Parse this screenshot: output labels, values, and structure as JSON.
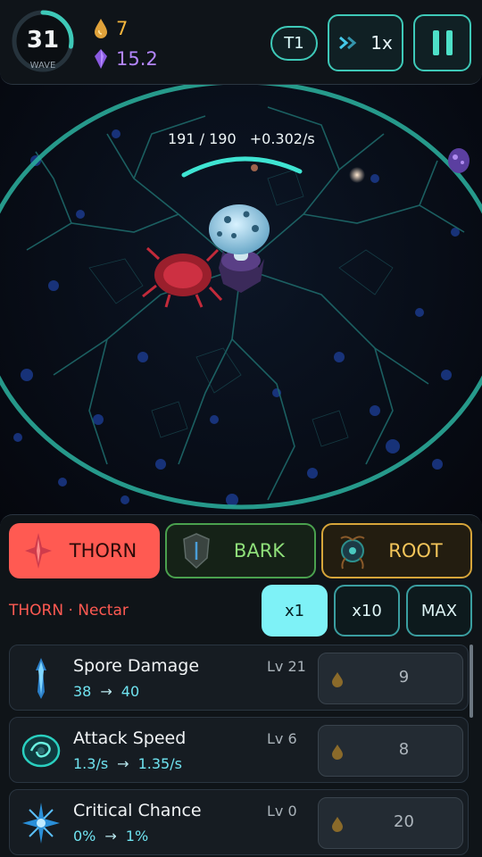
{
  "hud": {
    "wave_number": "31",
    "wave_label": "WAVE",
    "wave_progress": 0.28,
    "nectar_value": "7",
    "crystal_value": "15.2",
    "tier_label": "T1",
    "speed_label": "1x",
    "pause_icon": "pause-icon"
  },
  "battle": {
    "hp_text": "191 / 190",
    "regen_text": "+0.302/s"
  },
  "tabs": [
    {
      "label": "THORN",
      "icon": "thorn-icon",
      "active": true
    },
    {
      "label": "BARK",
      "icon": "bark-shield-icon",
      "active": false
    },
    {
      "label": "ROOT",
      "icon": "root-icon",
      "active": false
    }
  ],
  "section_label": "THORN · Nectar",
  "multipliers": [
    "x1",
    "x10",
    "MAX"
  ],
  "upgrades": [
    {
      "name": "Spore Damage",
      "level": "Lv 21",
      "current": "38",
      "next": "40",
      "cost": "9",
      "icon": "spore-spike-icon"
    },
    {
      "name": "Attack Speed",
      "level": "Lv 6",
      "current": "1.3/s",
      "next": "1.35/s",
      "cost": "8",
      "icon": "swirl-icon"
    },
    {
      "name": "Critical Chance",
      "level": "Lv 0",
      "current": "0%",
      "next": "1%",
      "cost": "20",
      "icon": "burst-icon"
    }
  ],
  "colors": {
    "accent_teal": "#3ec9b8",
    "thorn": "#ff5a52",
    "bark": "#4aa14e",
    "root": "#d6a53a",
    "nectar": "#f4b63d",
    "crystal": "#b486ff"
  }
}
